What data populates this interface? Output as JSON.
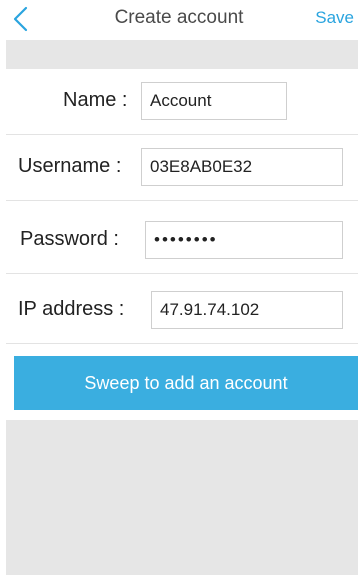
{
  "header": {
    "back_icon": "chevron-left-icon",
    "title": "Create account",
    "save_label": "Save",
    "accent_color": "#2aa4df"
  },
  "form": {
    "name": {
      "label": "Name :",
      "value": "Account"
    },
    "username": {
      "label": "Username :",
      "value": "03E8AB0E32"
    },
    "password": {
      "label": "Password :",
      "value": "••••••••"
    },
    "ip_address": {
      "label": "IP address :",
      "value": "47.91.74.102"
    }
  },
  "sweep_button": {
    "label": "Sweep to add an account",
    "color": "#3aaee0"
  }
}
